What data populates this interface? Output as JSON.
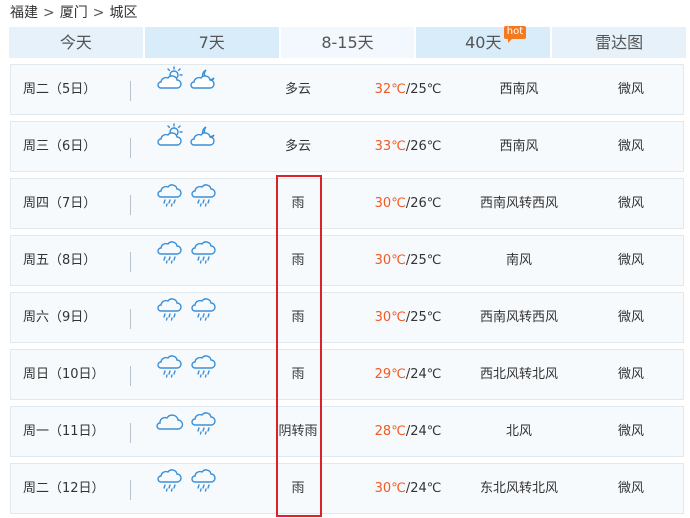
{
  "breadcrumb": {
    "items": [
      "福建",
      "厦门",
      "城区"
    ],
    "separator": ">"
  },
  "tabs": [
    {
      "label": "今天"
    },
    {
      "label": "7天"
    },
    {
      "label": "8-15天"
    },
    {
      "label": "40天",
      "badge": "hot"
    },
    {
      "label": "雷达图"
    }
  ],
  "colors": {
    "accent": "#f05a24",
    "highlight": "#d8232a",
    "tab_bg": "#e6f1fa",
    "icon_stroke": "#3b8fd6"
  },
  "forecast": [
    {
      "day": "周二（5日）",
      "icon_day": "partly-cloudy-sun-icon",
      "icon_night": "partly-cloudy-moon-icon",
      "condition": "多云",
      "high": "32℃",
      "low": "/25℃",
      "wind": "西南风",
      "level": "微风"
    },
    {
      "day": "周三（6日）",
      "icon_day": "partly-cloudy-sun-icon",
      "icon_night": "partly-cloudy-moon-icon",
      "condition": "多云",
      "high": "33℃",
      "low": "/26℃",
      "wind": "西南风",
      "level": "微风"
    },
    {
      "day": "周四（7日）",
      "icon_day": "rain-icon",
      "icon_night": "rain-icon",
      "condition": "雨",
      "high": "30℃",
      "low": "/26℃",
      "wind": "西南风转西风",
      "level": "微风"
    },
    {
      "day": "周五（8日）",
      "icon_day": "rain-icon",
      "icon_night": "rain-icon",
      "condition": "雨",
      "high": "30℃",
      "low": "/25℃",
      "wind": "南风",
      "level": "微风"
    },
    {
      "day": "周六（9日）",
      "icon_day": "rain-icon",
      "icon_night": "rain-icon",
      "condition": "雨",
      "high": "30℃",
      "low": "/25℃",
      "wind": "西南风转西风",
      "level": "微风"
    },
    {
      "day": "周日（10日）",
      "icon_day": "rain-icon",
      "icon_night": "rain-icon",
      "condition": "雨",
      "high": "29℃",
      "low": "/24℃",
      "wind": "西北风转北风",
      "level": "微风"
    },
    {
      "day": "周一（11日）",
      "icon_day": "cloudy-icon",
      "icon_night": "rain-icon",
      "condition": "阴转雨",
      "high": "28℃",
      "low": "/24℃",
      "wind": "北风",
      "level": "微风"
    },
    {
      "day": "周二（12日）",
      "icon_day": "rain-icon",
      "icon_night": "rain-icon",
      "condition": "雨",
      "high": "30℃",
      "low": "/24℃",
      "wind": "东北风转北风",
      "level": "微风"
    }
  ]
}
